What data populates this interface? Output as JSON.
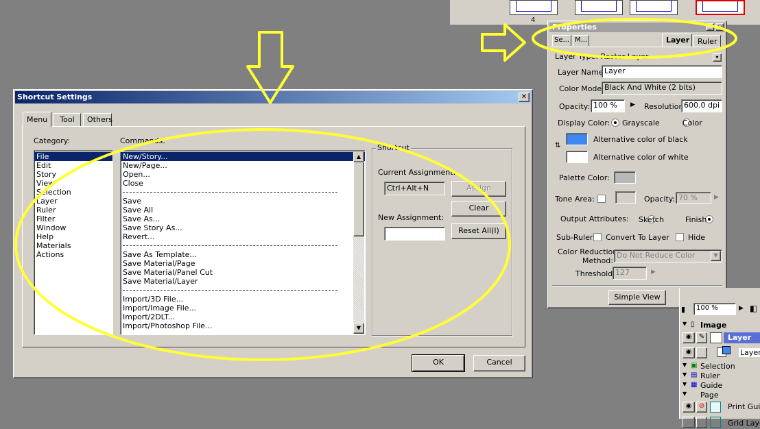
{
  "thumbs": {
    "page_number": "4"
  },
  "shortcut": {
    "title": "Shortcut Settings",
    "close_glyph": "✕",
    "tabs": [
      "Menu",
      "Tool",
      "Others"
    ],
    "category_label": "Category:",
    "commands_label": "Commands:",
    "categories": [
      "File",
      "Edit",
      "Story",
      "View",
      "Selection",
      "Layer",
      "Ruler",
      "Filter",
      "Window",
      "Help",
      "Materials",
      "Actions"
    ],
    "commands": [
      "New/Story...",
      "New/Page...",
      "Open...",
      "Close",
      "---",
      "Save",
      "Save All",
      "Save As...",
      "Save Story As...",
      "Revert...",
      "---",
      "Save As Template...",
      "Save Material/Page",
      "Save Material/Panel Cut",
      "Save Material/Layer",
      "---",
      "Import/3D File...",
      "Import/Image File...",
      "Import/2DLT...",
      "Import/Photoshop File..."
    ],
    "group_label": "Shortcut",
    "current_label": "Current Assignment:",
    "current_value": "Ctrl+Alt+N",
    "assign_label": "Assign",
    "clear_label": "Clear",
    "new_label": "New Assignment:",
    "new_value": "",
    "reset_label": "Reset All(I)",
    "ok_label": "OK",
    "cancel_label": "Cancel"
  },
  "props": {
    "title": "Properties",
    "tabs_small": [
      "Se...",
      "M..."
    ],
    "tab_layer": "Layer",
    "tab_ruler": "Ruler",
    "layer_type": "Layer Type: Raster Layer",
    "layer_name_label": "Layer Name:",
    "layer_name_value": "Layer",
    "color_model_label": "Color Model:",
    "color_model_value": "Black And White (2 bits)",
    "opacity_label": "Opacity:",
    "opacity_value": "100 %",
    "resolution_label": "Resolution:",
    "resolution_value": "600.0 dpi",
    "display_color_label": "Display Color:",
    "grayscale_label": "Grayscale",
    "color_label": "Color",
    "alt_black_label": "Alternative color of black",
    "alt_white_label": "Alternative color of white",
    "palette_label": "Palette Color:",
    "tone_area_label": "Tone Area:",
    "tone_opacity_label": "Opacity:",
    "tone_opacity_value": "70 %",
    "output_label": "Output Attributes:",
    "sketch_label": "Sketch",
    "finish_label": "Finish",
    "subruler_label": "Sub-Ruler:",
    "convert_label": "Convert To Layer",
    "hide_label": "Hide",
    "reduction_label_1": "Color Reduction",
    "reduction_label_2": "Method:",
    "reduction_value": "Do Not Reduce Color",
    "threshold_label": "Threshold:",
    "threshold_value": "127",
    "simple_view_label": "Simple View",
    "colors": {
      "black_alt": "#3f87f0",
      "white_alt": "#ffffff",
      "palette": "#b8b8b8"
    }
  },
  "layers": {
    "zoom_value": "100 %",
    "rows": [
      {
        "label": "Image",
        "kind": "group"
      },
      {
        "label": "Layer",
        "kind": "selected"
      },
      {
        "label": "Layer",
        "kind": "normal"
      },
      {
        "label": "Selection",
        "kind": "group"
      },
      {
        "label": "Ruler",
        "kind": "group"
      },
      {
        "label": "Guide",
        "kind": "group"
      },
      {
        "label": "Page",
        "kind": "group"
      },
      {
        "label": "Print Guide",
        "kind": "normal"
      },
      {
        "label": "Grid Layer",
        "kind": "normal"
      }
    ]
  },
  "annotation": {
    "color": "#ffff33"
  }
}
